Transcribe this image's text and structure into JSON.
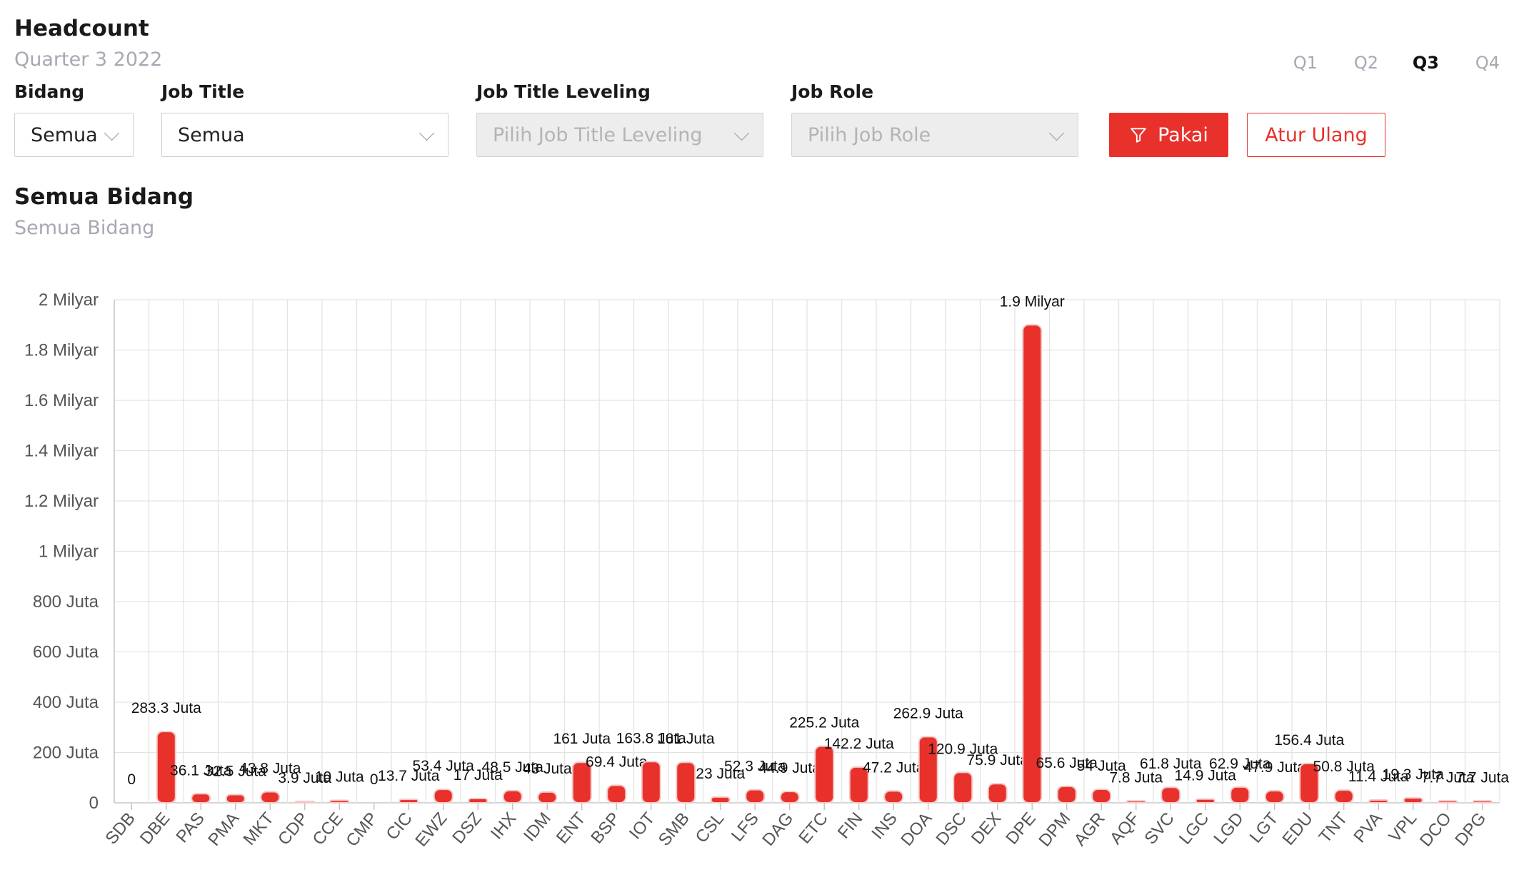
{
  "header": {
    "title": "Headcount",
    "subtitle": "Quarter 3 2022"
  },
  "quarters": [
    "Q1",
    "Q2",
    "Q3",
    "Q4"
  ],
  "active_quarter": "Q3",
  "filters": {
    "bidang": {
      "label": "Bidang",
      "value": "Semua"
    },
    "job_title": {
      "label": "Job Title",
      "value": "Semua"
    },
    "job_title_leveling": {
      "label": "Job Title Leveling",
      "placeholder": "Pilih Job Title Leveling"
    },
    "job_role": {
      "label": "Job Role",
      "placeholder": "Pilih Job Role"
    }
  },
  "buttons": {
    "apply": "Pakai",
    "reset": "Atur Ulang"
  },
  "section": {
    "title": "Semua Bidang",
    "subtitle": "Semua Bidang"
  },
  "colors": {
    "accent": "#e8312b",
    "muted": "#a8a8b4"
  },
  "icons": {
    "filter": "funnel-icon",
    "dropdown": "chevron-down-icon"
  },
  "chart_data": {
    "type": "bar",
    "categories": [
      "SDB",
      "DBE",
      "PAS",
      "PMA",
      "MKT",
      "CDP",
      "CCE",
      "CMP",
      "CIC",
      "EWZ",
      "DSZ",
      "IHX",
      "IDM",
      "ENT",
      "BSP",
      "IOT",
      "SMB",
      "CSL",
      "LFS",
      "DAG",
      "ETC",
      "FIN",
      "INS",
      "DOA",
      "DSC",
      "DEX",
      "DPE",
      "DPM",
      "AGR",
      "AQF",
      "SVC",
      "LGC",
      "LGD",
      "LGT",
      "EDU",
      "TNT",
      "PVA",
      "VPL",
      "DCO",
      "DPG"
    ],
    "values": [
      0,
      283300000,
      36100000,
      32500000,
      43800000,
      3900000,
      10000000,
      0,
      13700000,
      53400000,
      17000000,
      48500000,
      43000000,
      161000000,
      69400000,
      163800000,
      161000000,
      23000000,
      52300000,
      44900000,
      225200000,
      142200000,
      47200000,
      262900000,
      120900000,
      75900000,
      1900000000,
      65600000,
      54000000,
      7800000,
      61800000,
      14900000,
      62900000,
      47900000,
      156400000,
      50800000,
      11400000,
      19300000,
      7700000,
      7700000
    ],
    "labels": [
      "0",
      "283.3 Juta",
      "36.1 Juta",
      "32.5 Juta",
      "43.8 Juta",
      "3.9 Juta",
      "10 Juta",
      "0",
      "13.7 Juta",
      "53.4 Juta",
      "17 Juta",
      "48.5 Juta",
      "43 Juta",
      "161 Juta",
      "69.4 Juta",
      "163.8 Juta",
      "161 Juta",
      "23 Juta",
      "52.3 Juta",
      "44.9 Juta",
      "225.2 Juta",
      "142.2 Juta",
      "47.2 Juta",
      "262.9 Juta",
      "120.9 Juta",
      "75.9 Juta",
      "1.9 Milyar",
      "65.6 Juta",
      "54 Juta",
      "7.8 Juta",
      "61.8 Juta",
      "14.9 Juta",
      "62.9 Juta",
      "47.9 Juta",
      "156.4 Juta",
      "50.8 Juta",
      "11.4 Juta",
      "19.3 Juta",
      "7.7 Juta",
      "7.7 Juta"
    ],
    "yticks": [
      "0",
      "200 Juta",
      "400 Juta",
      "600 Juta",
      "800 Juta",
      "1 Milyar",
      "1.2 Milyar",
      "1.4 Milyar",
      "1.6 Milyar",
      "1.8 Milyar",
      "2 Milyar"
    ],
    "ylim": [
      0,
      2000000000
    ],
    "grid": true,
    "bar_color": "#e8312b"
  }
}
